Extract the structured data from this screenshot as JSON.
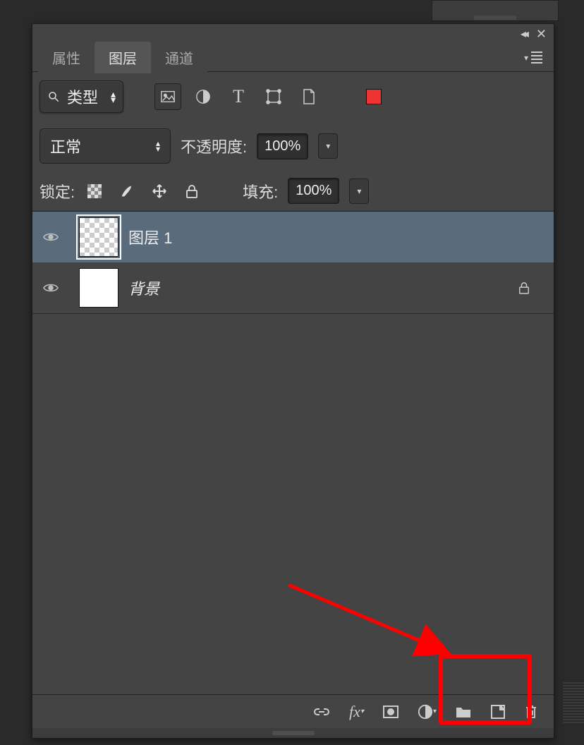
{
  "tabs": {
    "properties": "属性",
    "layers": "图层",
    "channels": "通道"
  },
  "filter": {
    "label": "类型"
  },
  "blend": {
    "mode": "正常",
    "opacity_label": "不透明度:",
    "opacity_value": "100%"
  },
  "lock": {
    "label": "锁定:",
    "fill_label": "填充:",
    "fill_value": "100%"
  },
  "layers": [
    {
      "name": "图层 1",
      "locked": false,
      "italic": false,
      "selected": true,
      "transparent": true
    },
    {
      "name": "背景",
      "locked": true,
      "italic": true,
      "selected": false,
      "transparent": false
    }
  ]
}
